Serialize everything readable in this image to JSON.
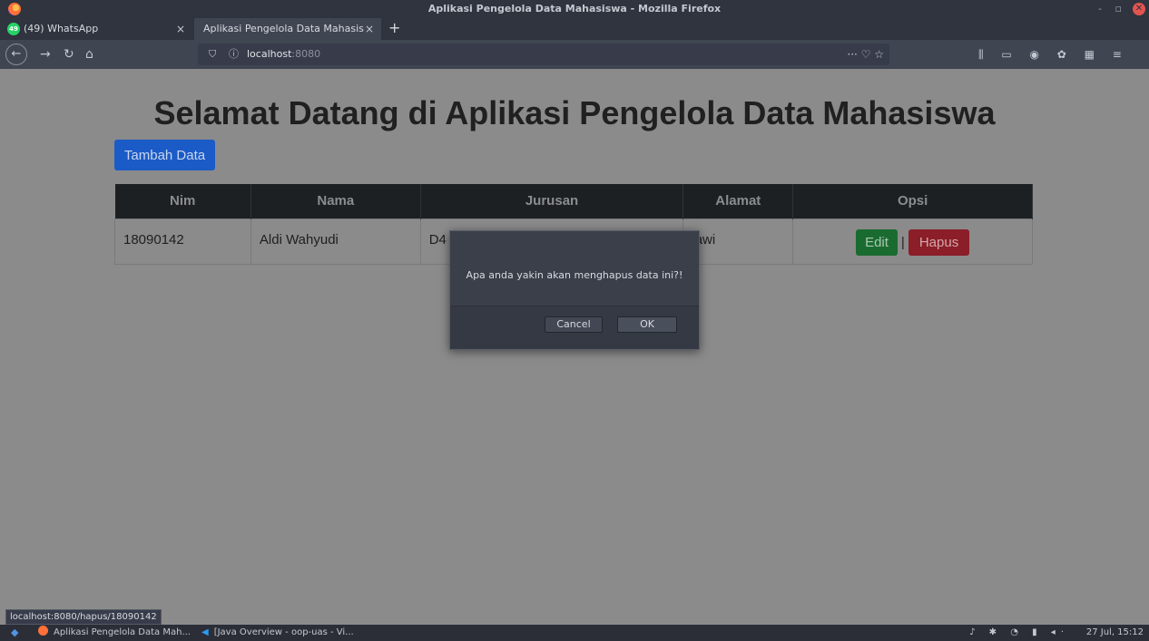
{
  "window": {
    "title": "Aplikasi Pengelola Data Mahasiswa - Mozilla Firefox",
    "minimize": "-",
    "maximize": "▫",
    "close": "✕"
  },
  "tabs": [
    {
      "label": "(49) WhatsApp",
      "badge": "49",
      "close": "×"
    },
    {
      "label": "Aplikasi Pengelola Data Mahasis",
      "close": "×"
    }
  ],
  "new_tab": "+",
  "nav": {
    "back": "←",
    "forward": "→",
    "reload": "↻",
    "home": "⌂",
    "url_host": "localhost",
    "url_port": ":8080",
    "right_icons": "··· ♡ ☆",
    "toolbar_icons": "⫼ ▭ ◉ ✿ ▦ ≡"
  },
  "page": {
    "title": "Selamat Datang di Aplikasi Pengelola Data Mahasiswa",
    "add_button": "Tambah Data",
    "table": {
      "headers": [
        "Nim",
        "Nama",
        "Jurusan",
        "Alamat",
        "Opsi"
      ],
      "rows": [
        {
          "nim": "18090142",
          "nama": "Aldi Wahyudi",
          "jurusan": "D4",
          "alamat": "lawi",
          "edit": "Edit",
          "sep": "|",
          "hapus": "Hapus"
        }
      ]
    }
  },
  "dialog": {
    "message": "Apa anda yakin akan menghapus data ini?!",
    "cancel": "Cancel",
    "ok": "OK"
  },
  "status_url": "localhost:8080/hapus/18090142",
  "taskbar": {
    "menu": "◆",
    "firefox": "Aplikasi Pengelola Data Mah...",
    "vscode_icon": "◀",
    "vscode": "[Java Overview - oop-uas - Vi...",
    "tray": "♪ ✱ ◔ ▮ ◂·",
    "clock": "27 Jul, 15:12"
  },
  "colors": {
    "page_bg": "#8b8b8b",
    "primary": "#1b5bc7",
    "success": "#1a6b30",
    "danger": "#8b1e28"
  }
}
